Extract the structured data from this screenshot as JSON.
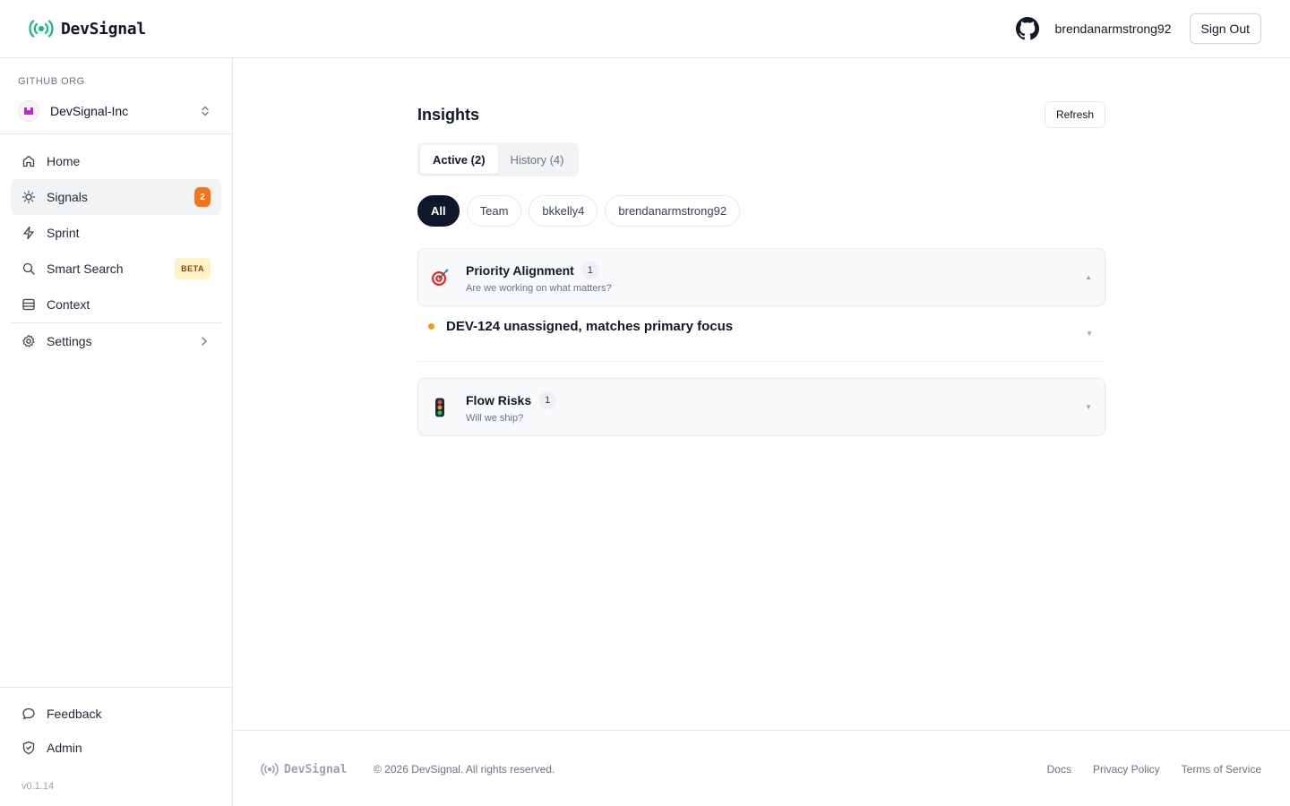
{
  "header": {
    "brand": "DevSignal",
    "username": "brendanarmstrong92",
    "signout_label": "Sign Out"
  },
  "sidebar": {
    "org_label": "GITHUB ORG",
    "org_name": "DevSignal-Inc",
    "items": [
      {
        "label": "Home",
        "icon": "home-icon"
      },
      {
        "label": "Signals",
        "icon": "lightbulb-icon",
        "badge": "2",
        "active": true
      },
      {
        "label": "Sprint",
        "icon": "lightning-icon"
      },
      {
        "label": "Smart Search",
        "icon": "search-icon",
        "badge": "BETA"
      },
      {
        "label": "Context",
        "icon": "database-icon"
      },
      {
        "label": "Settings",
        "icon": "gear-icon"
      }
    ],
    "bottom_items": [
      {
        "label": "Feedback",
        "icon": "message-icon"
      },
      {
        "label": "Admin",
        "icon": "shield-icon"
      }
    ],
    "version": "v0.1.14"
  },
  "main": {
    "title": "Insights",
    "refresh_label": "Refresh",
    "tabs": [
      {
        "label": "Active (2)",
        "active": true
      },
      {
        "label": "History (4)",
        "active": false
      }
    ],
    "filters": [
      {
        "label": "All",
        "active": true
      },
      {
        "label": "Team"
      },
      {
        "label": "bkkelly4"
      },
      {
        "label": "brendanarmstrong92"
      }
    ],
    "sections": [
      {
        "icon": "target-icon",
        "title": "Priority Alignment",
        "count": "1",
        "subtitle": "Are we working on what matters?",
        "expanded": true,
        "signals": [
          {
            "title": "DEV-124 unassigned, matches primary focus",
            "status_color": "#f59e0b"
          }
        ]
      },
      {
        "icon": "traffic-light-icon",
        "title": "Flow Risks",
        "count": "1",
        "subtitle": "Will we ship?",
        "expanded": false
      }
    ]
  },
  "footer": {
    "brand": "DevSignal",
    "copyright": "© 2026 DevSignal. All rights reserved.",
    "links": [
      "Docs",
      "Privacy Policy",
      "Terms of Service"
    ]
  },
  "colors": {
    "brand_green": "#10b981",
    "active_pill": "#0f172a",
    "badge_orange": "#f97316",
    "beta_bg": "#fef3c7"
  }
}
